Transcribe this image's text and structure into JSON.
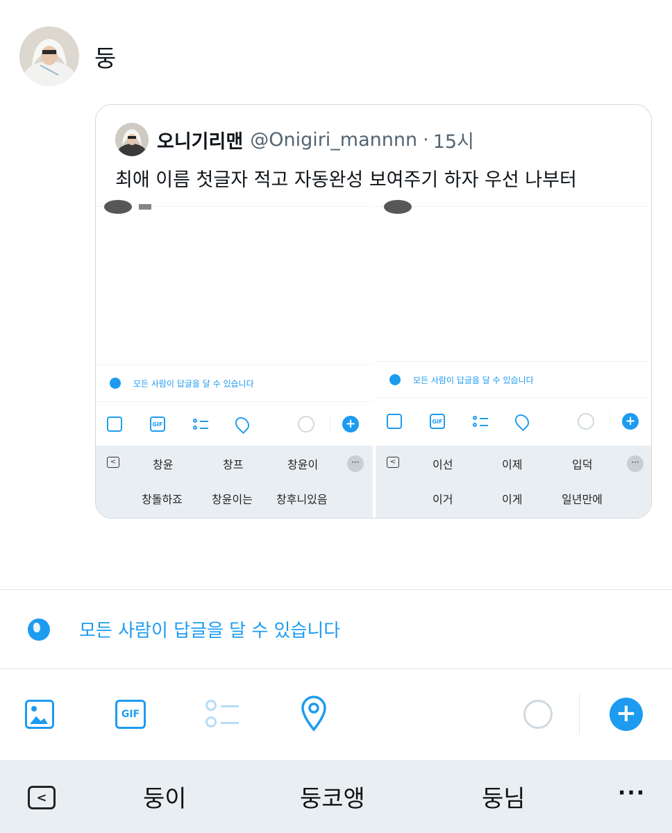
{
  "compose": {
    "text": "둥"
  },
  "quote": {
    "display_name": "오니기리맨",
    "handle": "@Onigiri_mannnn",
    "separator": "·",
    "time": "15시",
    "text": "최애 이름 첫글자 적고 자동완성 보여주기 하자 우선 나부터"
  },
  "shots": [
    {
      "reply_setting": "모든 사람이 답글을 달 수 있습니다",
      "suggestions_row1": [
        "창윤",
        "창프",
        "창윤이"
      ],
      "suggestions_row2": [
        "창돌하죠",
        "창윤이는",
        "창후니있음"
      ]
    },
    {
      "reply_setting": "모든 사람이 답글을 달 수 있습니다",
      "suggestions_row1": [
        "이선",
        "이제",
        "입덕"
      ],
      "suggestions_row2": [
        "이거",
        "이게",
        "일년만에"
      ]
    }
  ],
  "toolbar_icons": {
    "image": "image-icon",
    "gif": "GIF",
    "poll": "poll-icon",
    "location": "location-pin-icon",
    "progress": "char-count-ring",
    "add": "+"
  },
  "reply_setting": "모든 사람이 답글을 달 수 있습니다",
  "keyboard": {
    "back_label": "<",
    "suggestions": [
      "둥이",
      "둥코앵",
      "둥님"
    ],
    "more_label": "···"
  },
  "colors": {
    "accent": "#1d9bf0",
    "keyboard_bg": "#e9eef2"
  }
}
